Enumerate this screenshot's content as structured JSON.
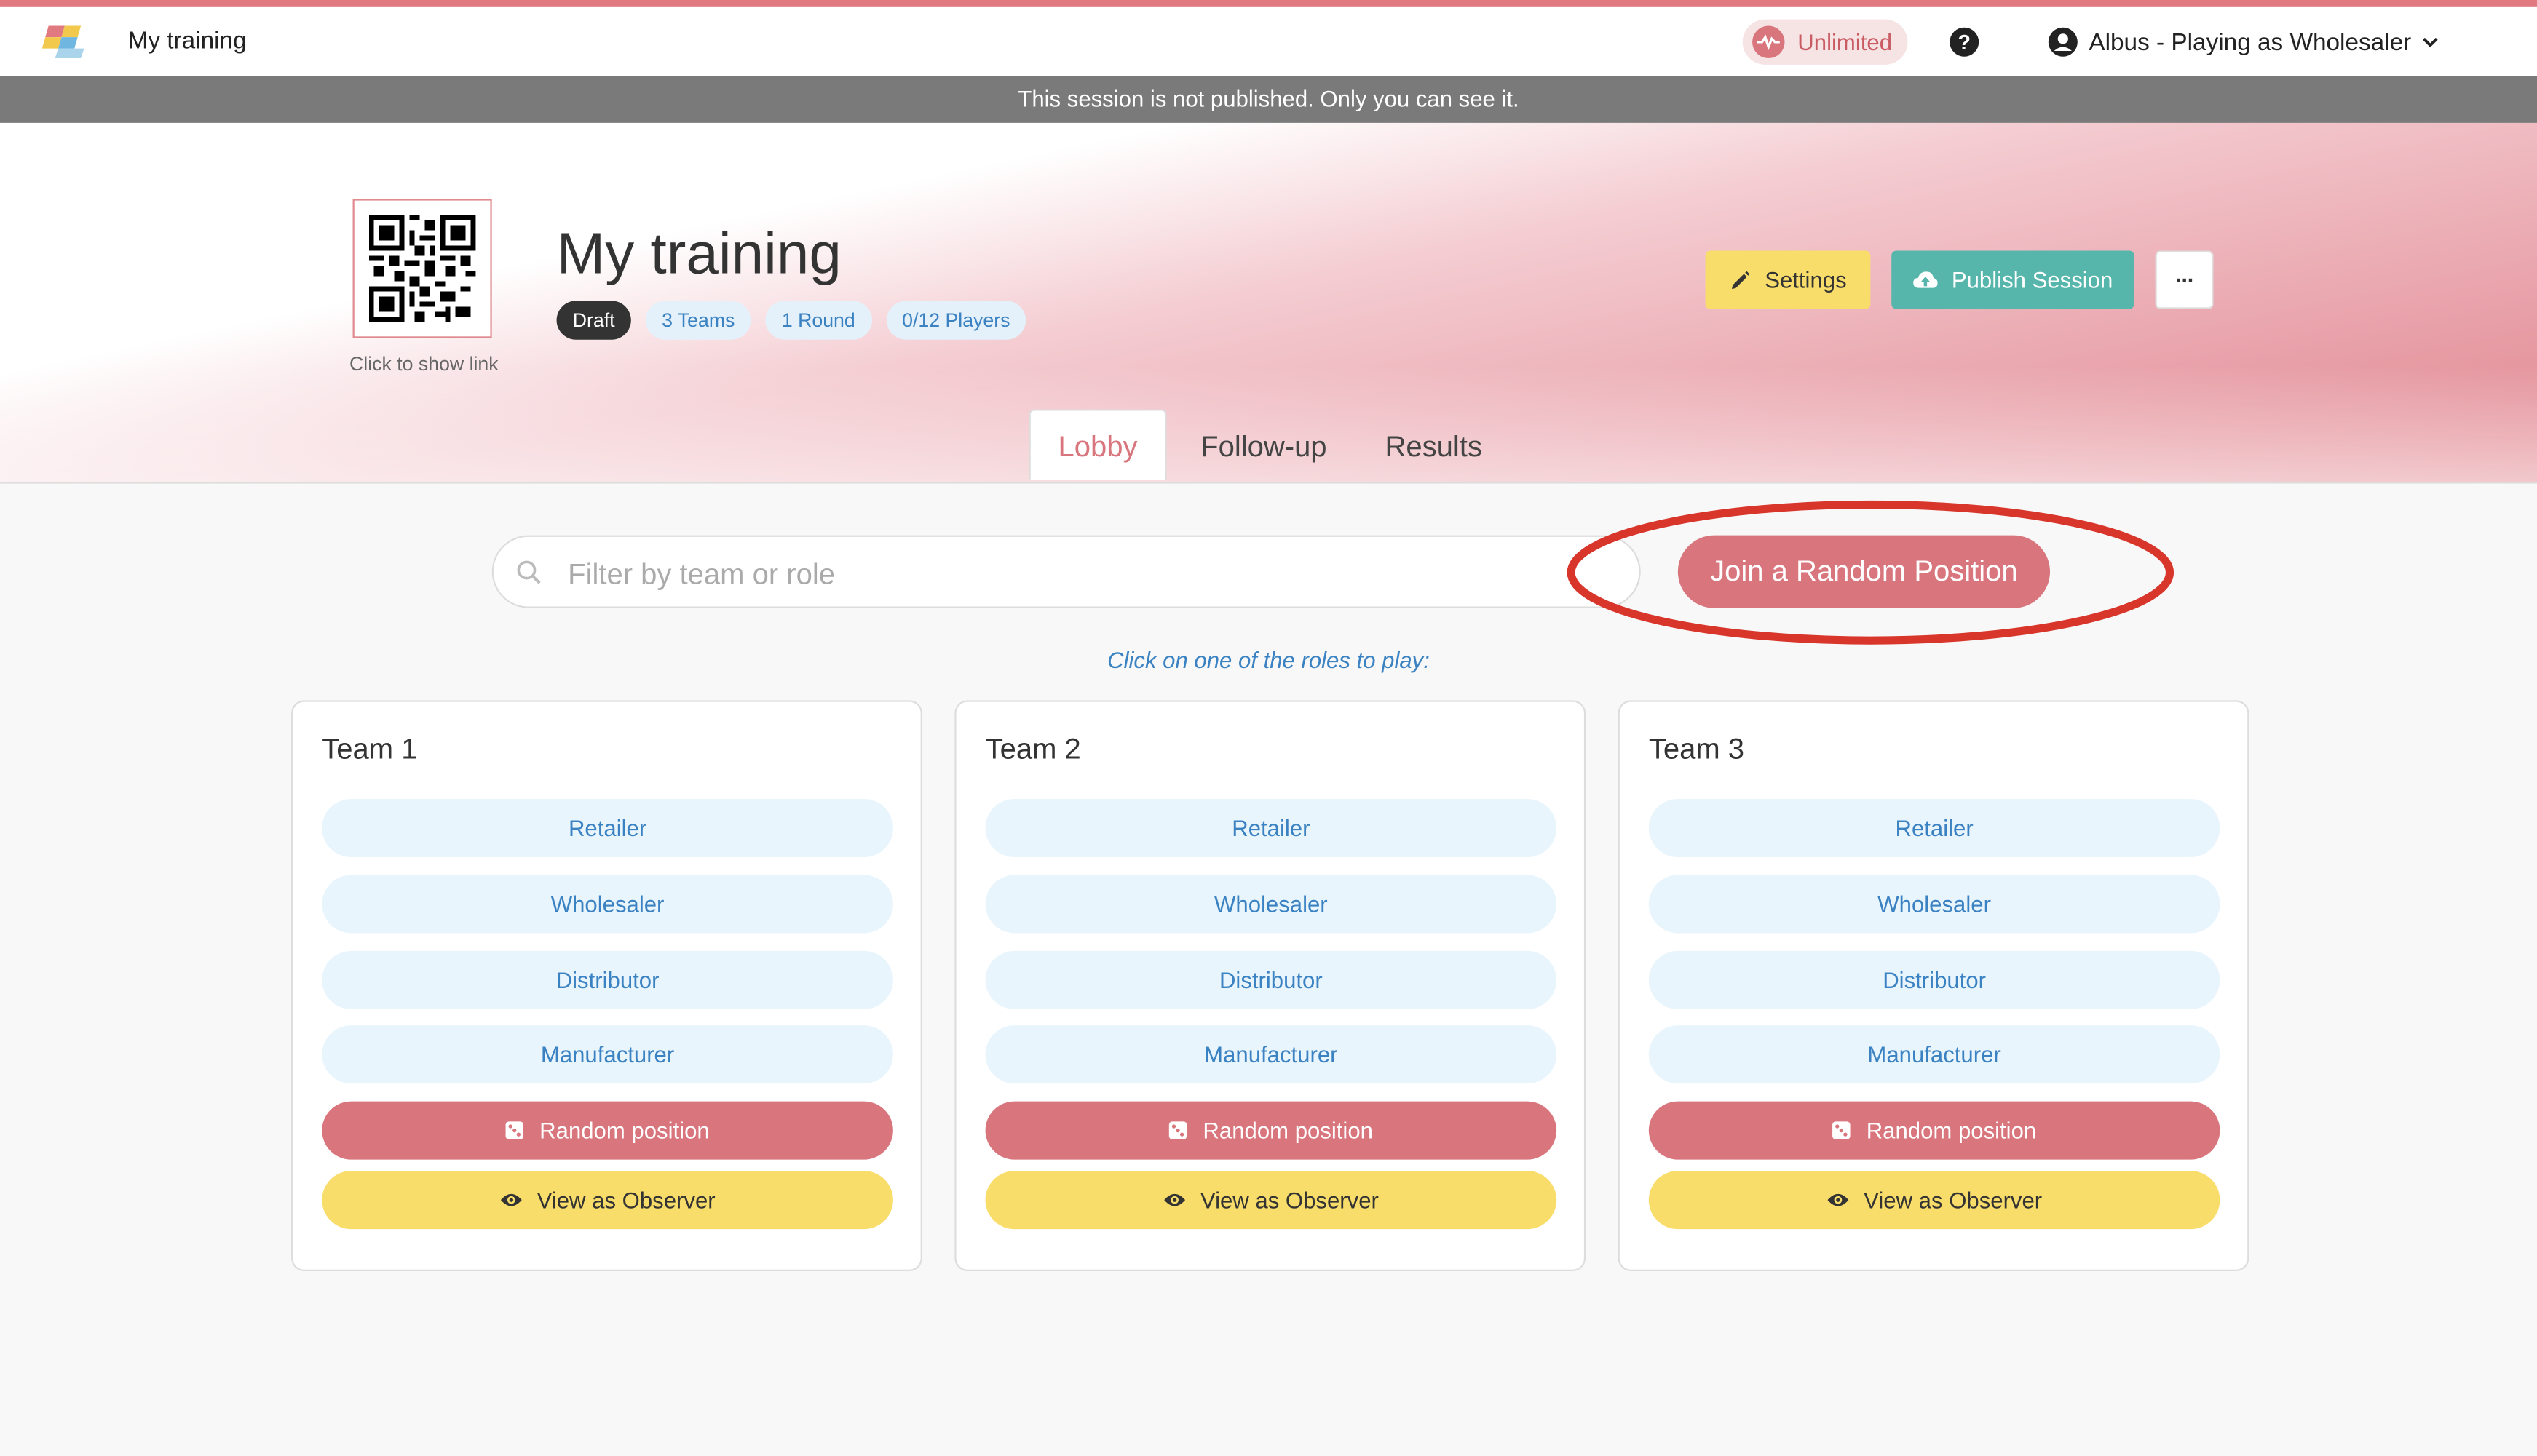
{
  "navbar": {
    "app_title": "My training",
    "plan_label": "Unlimited",
    "user_label": "Albus - Playing as Wholesaler"
  },
  "banner": {
    "text": "This session is not published. Only you can see it."
  },
  "session": {
    "qr_caption": "Click to show link",
    "title": "My training",
    "chips": [
      "Draft",
      "3 Teams",
      "1 Round",
      "0/12 Players"
    ]
  },
  "actions": {
    "settings_label": "Settings",
    "publish_label": "Publish Session",
    "more_label": "···"
  },
  "tabs": [
    "Lobby",
    "Follow-up",
    "Results"
  ],
  "search": {
    "placeholder": "Filter by team or role",
    "value": ""
  },
  "join_random_label": "Join a Random Position",
  "hint": "Click on one of the roles to play:",
  "teams": [
    {
      "name": "Team 1",
      "roles": [
        "Retailer",
        "Wholesaler",
        "Distributor",
        "Manufacturer"
      ],
      "random_label": "Random position",
      "observer_label": "View as Observer"
    },
    {
      "name": "Team 2",
      "roles": [
        "Retailer",
        "Wholesaler",
        "Distributor",
        "Manufacturer"
      ],
      "random_label": "Random position",
      "observer_label": "View as Observer"
    },
    {
      "name": "Team 3",
      "roles": [
        "Retailer",
        "Wholesaler",
        "Distributor",
        "Manufacturer"
      ],
      "random_label": "Random position",
      "observer_label": "View as Observer"
    }
  ],
  "colors": {
    "accent": "#d9767d",
    "primary_text": "#3a82c2",
    "settings": "#f9dd6b",
    "publish": "#57b6ab",
    "annotation": "#d9362b"
  }
}
